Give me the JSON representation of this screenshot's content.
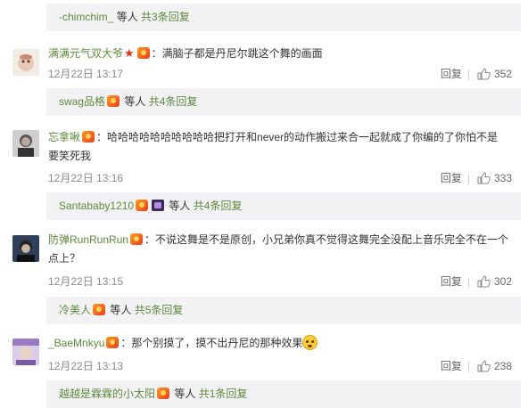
{
  "colors": {
    "accent_green": "#5c8a3a",
    "reply_bg": "#f2f2f5",
    "meta_gray": "#8a8a8a"
  },
  "reply_label": "回复",
  "reply_boxes": [
    {
      "user": "-chimchim_",
      "etc": "等人",
      "count": "共3条回复"
    },
    {
      "user": "swag品格",
      "etc": "等人",
      "count": "共4条回复"
    },
    {
      "user": "Santababy1210",
      "etc": "等人",
      "count": "共4条回复"
    },
    {
      "user": "冷美人",
      "etc": "等人",
      "count": "共5条回复"
    },
    {
      "user": "越越是霖霖的小太阳",
      "etc": "等人",
      "count": "共1条回复"
    }
  ],
  "comments": [
    {
      "user": "满满元气双大爷",
      "text": "：满脑子都是丹尼尔跳这个舞的画面",
      "text2": "",
      "time": "12月22日 13:17",
      "likes": "352"
    },
    {
      "user": "忘拿啾",
      "text": "：哈哈哈哈哈哈哈哈哈哈把打开和never的动作搬过来合一起就成了你编的了你怕不是",
      "text2": "要笑死我",
      "time": "12月22日 13:16",
      "likes": "333"
    },
    {
      "user": "防弹RunRunRun",
      "text": "：不说这舞是不是原创，小兄弟你真不觉得这舞完全没配上音乐完全不在一个",
      "text2": "点上？",
      "time": "12月22日 13:15",
      "likes": "302"
    },
    {
      "user": "_BaeMnkyu",
      "text": "：那个别摸了，摸不出丹尼的那种效果",
      "text2": "",
      "time": "12月22日 13:13",
      "likes": "238"
    }
  ]
}
